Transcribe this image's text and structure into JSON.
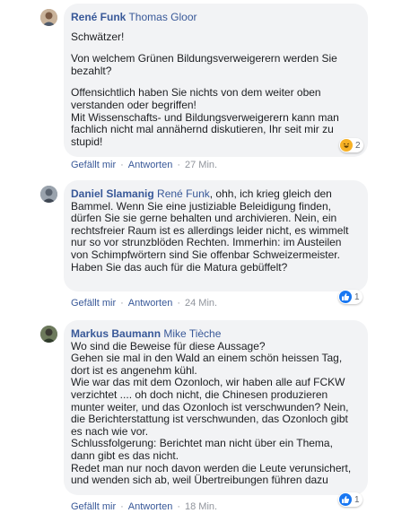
{
  "comments": [
    {
      "author": "René Funk",
      "mention": "Thomas Gloor",
      "paragraphs": [
        "Schwätzer!",
        "Von welchem Grünen Bildungsverweigerern werden Sie bezahlt?",
        "Offensichtlich haben Sie nichts von dem weiter oben verstanden oder begriffen!\nMit Wissenschafts- und Bildungsverweigerern kann man fachlich nicht mal annähernd diskutieren, Ihr seit mir zu stupid!"
      ],
      "reaction": {
        "icon": "haha-icon",
        "count": "2",
        "color": "#f7b125"
      },
      "actions": {
        "like": "Gefällt mir",
        "reply": "Antworten",
        "time": "27 Min."
      }
    },
    {
      "author": "Daniel Slamanig",
      "mention": "René Funk",
      "text_after_mention": ", ohh, ich krieg gleich den Bammel. Wenn Sie eine justiziable Beleidigung finden, dürfen Sie sie gerne behalten und archivieren. Nein, ein rechtsfreier Raum ist es allerdings leider nicht, es wimmelt nur so vor strunzblöden Rechten. Immerhin: im Austeilen von Schimpfwörtern sind Sie offenbar Schweizermeister. Haben Sie das auch für die Matura gebüffelt?",
      "reaction": {
        "icon": "like-icon",
        "count": "1",
        "color": "#1877f2"
      },
      "actions": {
        "like": "Gefällt mir",
        "reply": "Antworten",
        "time": "24 Min."
      }
    },
    {
      "author": "Markus Baumann",
      "mention": "Mike Tièche",
      "lines": [
        "Wo sind die Beweise für diese Aussage?",
        "Gehen sie mal in den Wald an einem schön heissen Tag, dort ist es angenehm kühl.",
        "Wie war das mit dem Ozonloch, wir haben alle auf FCKW verzichtet .... oh doch nicht, die Chinesen produzieren munter weiter, und das Ozonloch ist verschwunden? Nein, die Berichterstattung ist verschwunden, das Ozonloch gibt es nach wie vor.",
        "Schlussfolgerung: Berichtet man nicht über ein Thema, dann gibt es das nicht.",
        "Redet man nur noch davon werden die Leute verunsichert, und wenden sich ab, weil Übertreibungen führen dazu"
      ],
      "reaction": {
        "icon": "like-icon",
        "count": "1",
        "color": "#1877f2"
      },
      "actions": {
        "like": "Gefällt mir",
        "reply": "Antworten",
        "time": "18 Min."
      }
    }
  ]
}
